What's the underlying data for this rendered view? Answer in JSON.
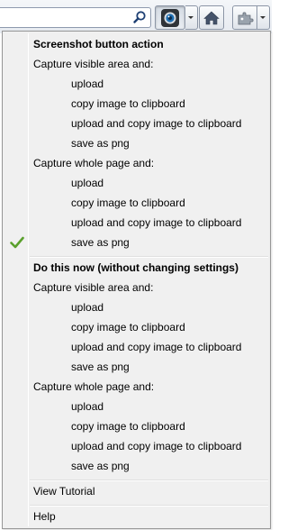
{
  "toolbar": {
    "search_value": "",
    "icons": [
      "search-icon",
      "screenshot-camera-icon",
      "dropdown-arrow-icon",
      "home-icon",
      "addon-puzzle-icon",
      "dropdown-arrow-icon"
    ]
  },
  "menu": {
    "section1": {
      "header": "Screenshot button action",
      "visible_label": "Capture visible area and:",
      "visible_items": [
        "upload",
        "copy image to clipboard",
        "upload and copy image to clipboard",
        "save as png"
      ],
      "whole_label": "Capture whole page and:",
      "whole_items": [
        "upload",
        "copy image to clipboard",
        "upload and copy image to clipboard",
        "save as png"
      ],
      "checked": "whole page: save as png"
    },
    "section2": {
      "header": "Do this now (without changing settings)",
      "visible_label": "Capture visible area and:",
      "visible_items": [
        "upload",
        "copy image to clipboard",
        "upload and copy image to clipboard",
        "save as png"
      ],
      "whole_label": "Capture whole page and:",
      "whole_items": [
        "upload",
        "copy image to clipboard",
        "upload and copy image to clipboard",
        "save as png"
      ]
    },
    "view_tutorial": "View Tutorial",
    "help": "Help"
  },
  "colors": {
    "menu_background": "#f0f0f0",
    "checkmark": "#5aa02c",
    "toolbar_border": "#8c96a6"
  }
}
